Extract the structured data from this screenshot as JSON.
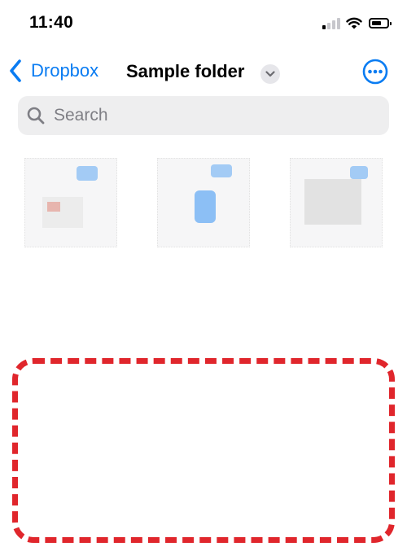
{
  "status_bar": {
    "time": "11:40"
  },
  "nav": {
    "back_label": "Dropbox",
    "title": "Sample folder"
  },
  "search": {
    "placeholder": "Search"
  },
  "files": [
    {
      "name": "",
      "meta": ""
    },
    {
      "name": "",
      "meta": ""
    },
    {
      "name": "",
      "meta": ""
    }
  ],
  "colors": {
    "accent": "#0a7cf2",
    "highlight_border": "#e0262c",
    "search_background": "#eeeeef"
  },
  "icons": {
    "back": "chevron-left-icon",
    "dropdown": "chevron-down-icon",
    "more": "more-circle-icon",
    "search": "search-icon",
    "signal": "cellular-signal-icon",
    "wifi": "wifi-icon",
    "battery": "battery-icon"
  }
}
